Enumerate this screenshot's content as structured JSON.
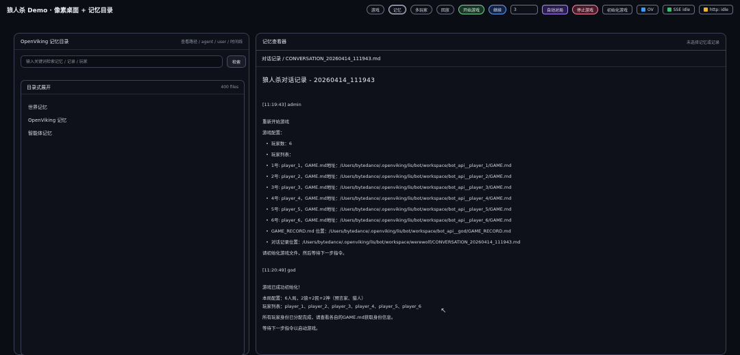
{
  "header": {
    "title": "狼人杀 Demo · 像素桌面 + 记忆目录",
    "buttons": {
      "game": "游戏",
      "memory": "记忆",
      "multiplayer": "多玩家",
      "replay": "回放",
      "start_game": "开始游戏",
      "continue": "继续",
      "auto_play": "自动对局",
      "stop_game": "停止游戏",
      "init_game": "初始化游戏",
      "tag_ov": "OV",
      "tag_sse": "SSE idle",
      "tag_http": "http: idle"
    },
    "rounds_value": "3",
    "tag_colors": {
      "ov": "#3b9cff",
      "sse": "#38c172",
      "http": "#f0b429"
    }
  },
  "left": {
    "title": "OpenViking 记忆目录",
    "hint": "查看路径 / agent / user / 时间线",
    "search_placeholder": "输入关键词检索记忆 / 记录 / 玩家",
    "search_button": "检索",
    "tree_title": "目录式展开",
    "tree_count": "400 files",
    "items": [
      "世界记忆",
      "OpenViking 记忆",
      "智能体记忆"
    ]
  },
  "right": {
    "title": "记忆查看器",
    "hint": "未选择记忆或记录",
    "path": "对话记录 / CONVERSATION_20260414_111943.md",
    "doc_title": "狼人杀对话记录 - 20260414_111943",
    "lines": {
      "s1": "[11:19:43] admin",
      "s1a": "重新开始游戏",
      "s1b": "游戏配置：",
      "b1": "玩家数：6",
      "b2": "玩家列表：",
      "b3": "1号: player_1，GAME.md地址：/Users/bytedance/.openviking/lis/bot/workspace/bot_api__player_1/GAME.md",
      "b4": "2号: player_2，GAME.md地址：/Users/bytedance/.openviking/lis/bot/workspace/bot_api__player_2/GAME.md",
      "b5": "3号: player_3，GAME.md地址：/Users/bytedance/.openviking/lis/bot/workspace/bot_api__player_3/GAME.md",
      "b6": "4号: player_4，GAME.md地址：/Users/bytedance/.openviking/lis/bot/workspace/bot_api__player_4/GAME.md",
      "b7": "5号: player_5，GAME.md地址：/Users/bytedance/.openviking/lis/bot/workspace/bot_api__player_5/GAME.md",
      "b8": "6号: player_6，GAME.md地址：/Users/bytedance/.openviking/lis/bot/workspace/bot_api__player_6/GAME.md",
      "b9": "GAME_RECORD.md 位置：/Users/bytedance/.openviking/lis/bot/workspace/bot_api__god/GAME_RECORD.md",
      "b10": "对话记录位置：/Users/bytedance/.openviking/lis/bot/workspace/werewolf/CONVERSATION_20260414_111943.md",
      "s1c": "请初始化游戏文件，然后等待下一步指令。",
      "s2": "[11:20:49] god",
      "s2a": "游戏已成功初始化！",
      "s2b": "本局配置：6人局，2狼+2民+2神（预言家、猎人）",
      "s2c": "玩家列表：player_1、player_2、player_3、player_4、player_5、player_6",
      "s2d": "所有玩家身份已分配完成，请查看各自的GAME.md获取身份信息。",
      "s2e": "等待下一步指令以启动游戏。"
    }
  }
}
